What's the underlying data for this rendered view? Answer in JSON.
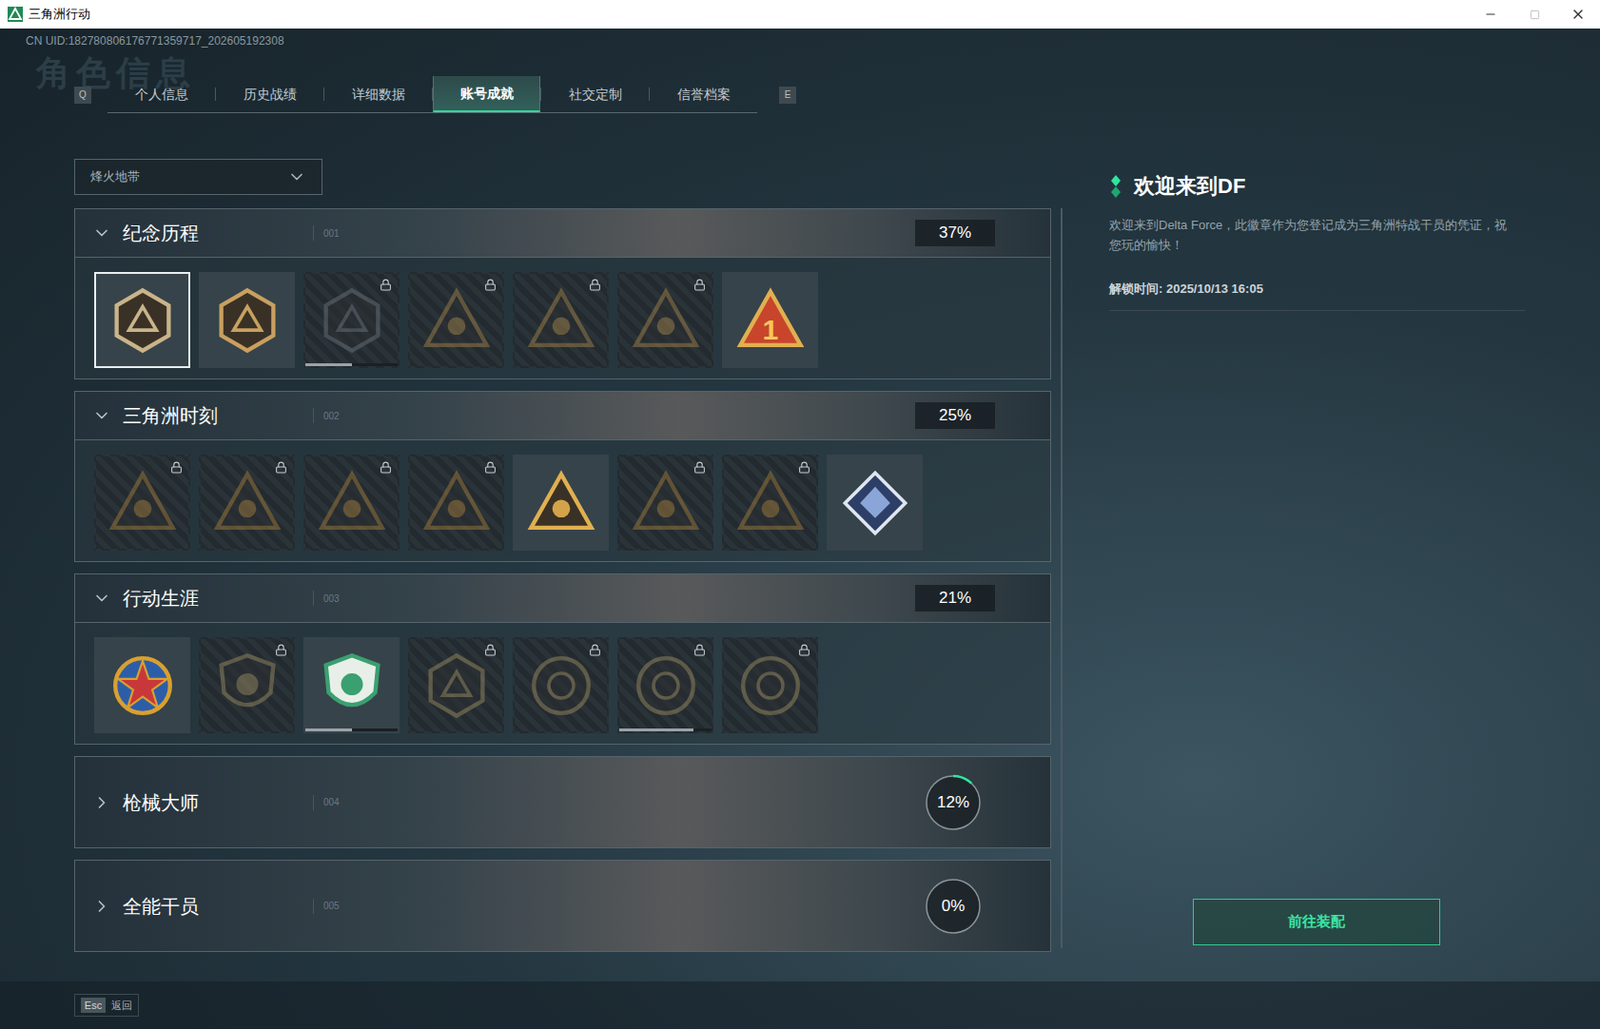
{
  "window": {
    "title": "三角洲行动"
  },
  "uid": "CN UID:182780806176771359717_202605192308",
  "watermark": "角色信息",
  "tab_keys": {
    "prev": "Q",
    "next": "E"
  },
  "tabs": [
    {
      "label": "个人信息",
      "selected": false
    },
    {
      "label": "历史战绩",
      "selected": false
    },
    {
      "label": "详细数据",
      "selected": false
    },
    {
      "label": "账号成就",
      "selected": true
    },
    {
      "label": "社交定制",
      "selected": false
    },
    {
      "label": "信誉档案",
      "selected": false
    }
  ],
  "mode_select": {
    "value": "烽火地带"
  },
  "sections": [
    {
      "title": "纪念历程",
      "index": "001",
      "percent": "37%",
      "expanded": true,
      "badges": [
        {
          "kind": "hex",
          "color": "#c9b48a",
          "locked": false,
          "selected": true,
          "level": 0,
          "label": ""
        },
        {
          "kind": "hex",
          "color": "#c8a060",
          "locked": false,
          "selected": false,
          "level": 0,
          "label": ""
        },
        {
          "kind": "hex",
          "color": "#6a6f78",
          "locked": true,
          "selected": false,
          "level": 0.5,
          "label": ""
        },
        {
          "kind": "triangle",
          "color": "#a08048",
          "locked": true,
          "selected": false,
          "level": 0,
          "label": ""
        },
        {
          "kind": "triangle",
          "color": "#a08048",
          "locked": true,
          "selected": false,
          "level": 0,
          "label": ""
        },
        {
          "kind": "triangle",
          "color": "#a08048",
          "locked": true,
          "selected": false,
          "level": 0,
          "label": ""
        },
        {
          "kind": "triangle",
          "color": "#c8452c",
          "locked": false,
          "selected": false,
          "level": 0,
          "label": "1"
        }
      ]
    },
    {
      "title": "三角洲时刻",
      "index": "002",
      "percent": "25%",
      "expanded": true,
      "badges": [
        {
          "kind": "triangle",
          "color": "#a07a3a",
          "locked": true,
          "selected": false,
          "level": 0,
          "label": ""
        },
        {
          "kind": "triangle",
          "color": "#a07a3a",
          "locked": true,
          "selected": false,
          "level": 0,
          "label": ""
        },
        {
          "kind": "triangle",
          "color": "#a07a3a",
          "locked": true,
          "selected": false,
          "level": 0,
          "label": ""
        },
        {
          "kind": "triangle",
          "color": "#a07a3a",
          "locked": true,
          "selected": false,
          "level": 0,
          "label": ""
        },
        {
          "kind": "triangle",
          "color": "#d4a24a",
          "locked": false,
          "selected": false,
          "level": 0,
          "label": ""
        },
        {
          "kind": "triangle",
          "color": "#a07a3a",
          "locked": true,
          "selected": false,
          "level": 0,
          "label": ""
        },
        {
          "kind": "triangle",
          "color": "#a07a3a",
          "locked": true,
          "selected": false,
          "level": 0,
          "label": ""
        },
        {
          "kind": "diamond",
          "color": "#8aa6d8",
          "locked": false,
          "selected": false,
          "level": 0,
          "label": ""
        }
      ]
    },
    {
      "title": "行动生涯",
      "index": "003",
      "percent": "21%",
      "expanded": true,
      "badges": [
        {
          "kind": "star",
          "color": "#d8a030",
          "locked": false,
          "selected": false,
          "level": 0,
          "label": ""
        },
        {
          "kind": "shield",
          "color": "#9a8a60",
          "locked": true,
          "selected": false,
          "level": 0,
          "label": ""
        },
        {
          "kind": "shield",
          "color": "#3aa070",
          "locked": false,
          "selected": false,
          "level": 0.5,
          "label": ""
        },
        {
          "kind": "hex",
          "color": "#9a8a60",
          "locked": true,
          "selected": false,
          "level": 0,
          "label": ""
        },
        {
          "kind": "circle",
          "color": "#9a8a60",
          "locked": true,
          "selected": false,
          "level": 0,
          "label": ""
        },
        {
          "kind": "circle",
          "color": "#9a8a60",
          "locked": true,
          "selected": false,
          "level": 0.8,
          "label": ""
        },
        {
          "kind": "circle",
          "color": "#9a8a60",
          "locked": true,
          "selected": false,
          "level": 0,
          "label": ""
        }
      ]
    },
    {
      "title": "枪械大师",
      "index": "004",
      "percent": "12%",
      "expanded": false,
      "level": 0.12,
      "badges": []
    },
    {
      "title": "全能干员",
      "index": "005",
      "percent": "0%",
      "expanded": false,
      "level": 0,
      "badges": []
    }
  ],
  "detail": {
    "title": "欢迎来到DF",
    "description": "欢迎来到Delta Force，此徽章作为您登记成为三角洲特战干员的凭证，祝您玩的愉快！",
    "unlock_time": "解锁时间: 2025/10/13 16:05",
    "button": "前往装配"
  },
  "footer": {
    "key": "Esc",
    "label": "返回"
  }
}
